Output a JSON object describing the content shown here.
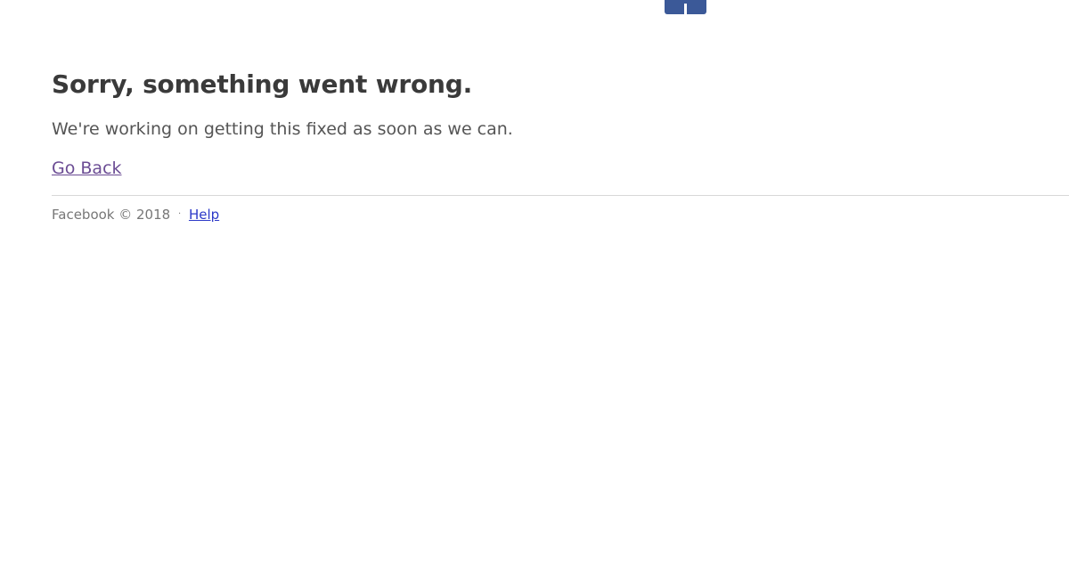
{
  "brand": {
    "logo_icon": "facebook-logo-icon",
    "color": "#3b5998"
  },
  "error": {
    "title": "Sorry, something went wrong.",
    "message": "We're working on getting this fixed as soon as we can.",
    "go_back_label": "Go Back"
  },
  "footer": {
    "copyright": "Facebook © 2018",
    "separator": "·",
    "help_label": "Help"
  },
  "colors": {
    "title": "#3a3a3a",
    "text": "#555555",
    "visited_link": "#6b4c94",
    "link": "#2b38c8",
    "divider": "#d8d8d8"
  }
}
